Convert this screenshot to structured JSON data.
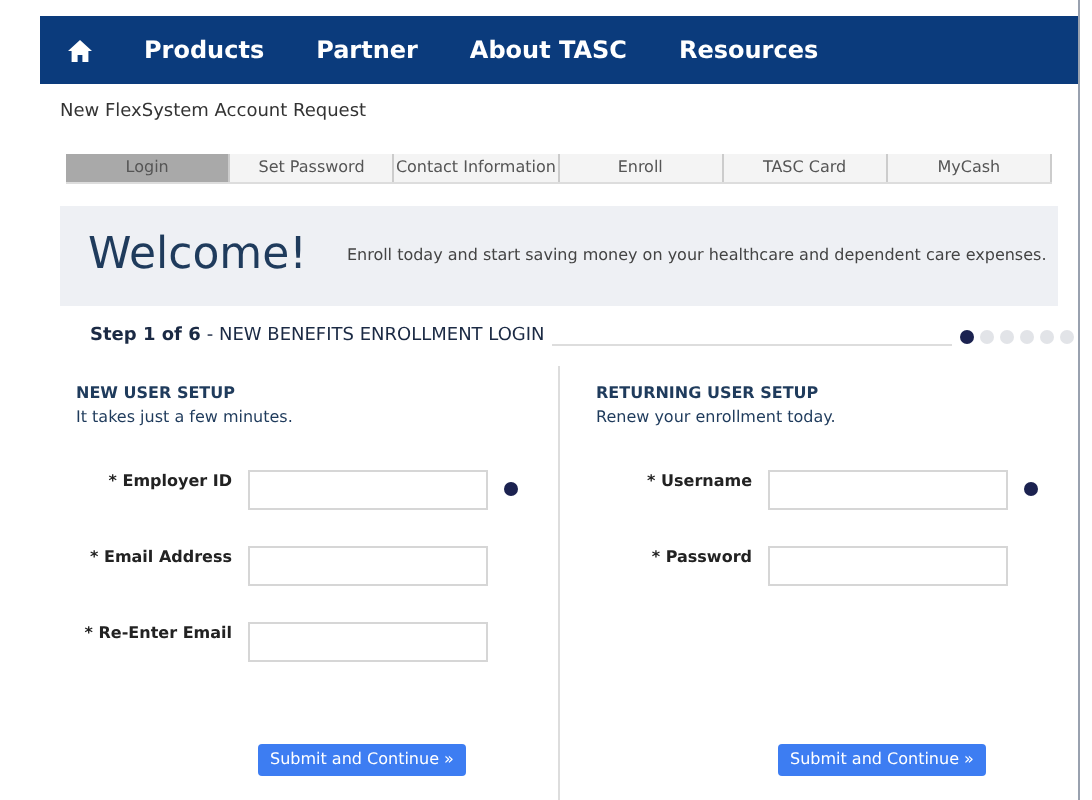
{
  "nav": {
    "items": [
      "Products",
      "Partner",
      "About TASC",
      "Resources"
    ]
  },
  "page_title": "New FlexSystem Account Request",
  "tabs": [
    {
      "label": "Login",
      "selected": true
    },
    {
      "label": "Set Password",
      "selected": false
    },
    {
      "label": "Contact Information",
      "selected": false
    },
    {
      "label": "Enroll",
      "selected": false
    },
    {
      "label": "TASC Card",
      "selected": false
    },
    {
      "label": "MyCash",
      "selected": false
    }
  ],
  "banner": {
    "title": "Welcome!",
    "text": "Enroll today and start saving money on your healthcare and dependent care expenses."
  },
  "step": {
    "number": "Step 1 of 6",
    "title": "- NEW BENEFITS ENROLLMENT LOGIN",
    "dots": [
      {
        "selected": true
      },
      {
        "selected": false
      },
      {
        "selected": false
      },
      {
        "selected": false
      },
      {
        "selected": false
      },
      {
        "selected": false
      }
    ]
  },
  "sections": [
    {
      "heading": "NEW USER SETUP",
      "subheading": "It takes just a few minutes.",
      "fields": [
        {
          "label": "* Employer ID",
          "info": true
        },
        {
          "label": "* Email Address",
          "info": false
        },
        {
          "label": "* Re-Enter Email",
          "info": false
        }
      ],
      "button": "Submit and Continue »"
    },
    {
      "heading": "RETURNING USER SETUP",
      "subheading": "Renew your enrollment today.",
      "fields": [
        {
          "label": "* Username",
          "info": true
        },
        {
          "label": "* Password",
          "info": false
        }
      ],
      "button": "Submit and Continue »"
    }
  ]
}
